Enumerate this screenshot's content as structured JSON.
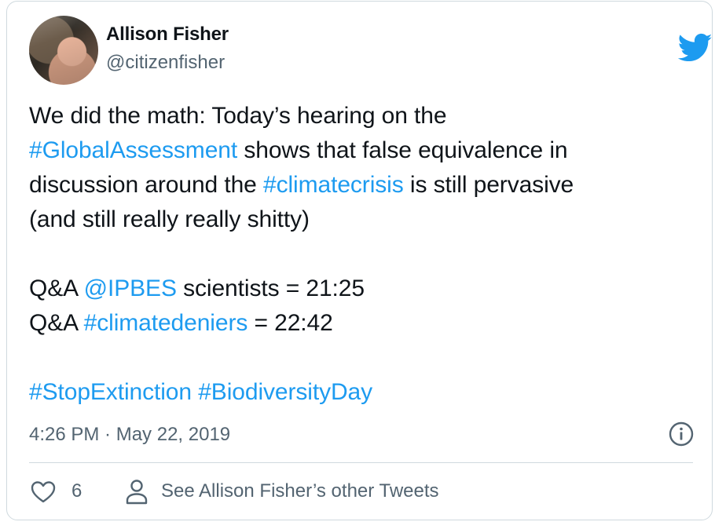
{
  "author": {
    "name": "Allison Fisher",
    "handle": "@citizenfisher"
  },
  "tweet": {
    "line1": "We did the math: Today’s hearing on the",
    "line2_tag": "#GlobalAssessment",
    "line2_rest": " shows that false equivalence in",
    "line3_start": "discussion around the ",
    "line3_tag": "#climatecrisis",
    "line3_rest": " is still pervasive",
    "line4": "(and still really really shitty)",
    "qa1_prefix": "Q&A ",
    "qa1_mention": "@IPBES",
    "qa1_rest": " scientists = 21:25",
    "qa2_prefix": "Q&A ",
    "qa2_tag": "#climatedeniers",
    "qa2_rest": " = 22:42",
    "tag_extinction": "#StopExtinction",
    "tag_biodiversity": "#BiodiversityDay"
  },
  "meta": {
    "timestamp": "4:26 PM · May 22, 2019"
  },
  "actions": {
    "like_count": "6",
    "other_tweets_label": "See Allison Fisher’s other Tweets"
  },
  "icons": {
    "brand": "twitter-bird-icon",
    "info": "info-icon",
    "like": "heart-icon",
    "profile": "person-icon"
  },
  "colors": {
    "link": "#1d9bf0",
    "text": "#0f1419",
    "secondary": "#536471",
    "border": "#cfd9de",
    "brand": "#1d9bf0"
  }
}
